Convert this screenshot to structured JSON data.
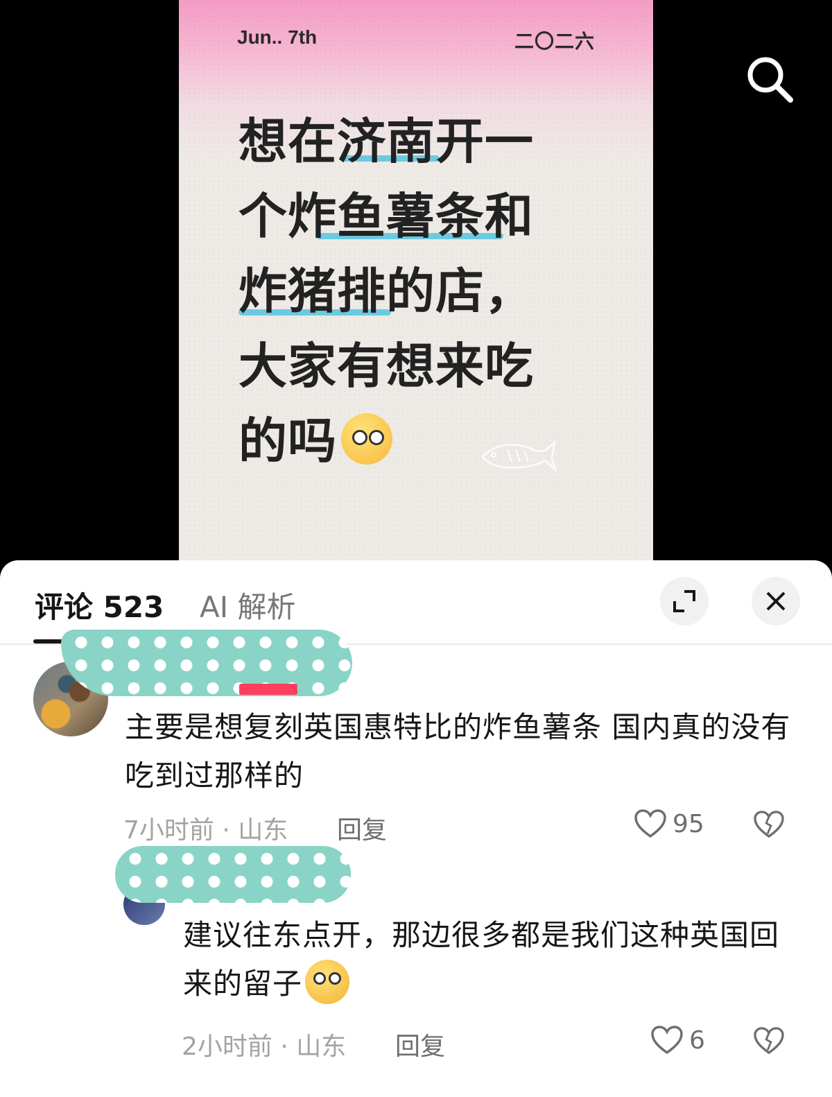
{
  "poster": {
    "date_left": "Jun.. 7th",
    "date_right": "二〇二六",
    "lines": [
      "想在济南开一",
      "个炸鱼薯条和",
      "炸猪排的店，",
      "大家有想来吃",
      "的吗"
    ],
    "emoji": "flushed-face-emoji",
    "highlight_color": "#5cc6e0"
  },
  "tabs": {
    "comments_label": "评论 523",
    "ai_label": "AI 解析"
  },
  "comments": [
    {
      "text": "主要是想复刻英国惠特比的炸鱼薯条 国内真的没有吃到过那样的",
      "meta": "7小时前 · 山东",
      "reply_label": "回复",
      "likes": "95"
    },
    {
      "text": "建议往东点开，那边很多都是我们这种英国回来的留子",
      "emoji": "pleading-face-emoji",
      "meta": "2小时前 · 山东",
      "reply_label": "回复",
      "likes": "6"
    }
  ],
  "icons": {
    "search": "search-icon",
    "expand": "expand-icon",
    "close": "close-icon",
    "like": "heart-icon",
    "dislike": "broken-heart-icon"
  },
  "colors": {
    "poster_pink": "#f49cc4",
    "redaction": "#89d4c6",
    "pin_badge": "#ff3e5e"
  }
}
